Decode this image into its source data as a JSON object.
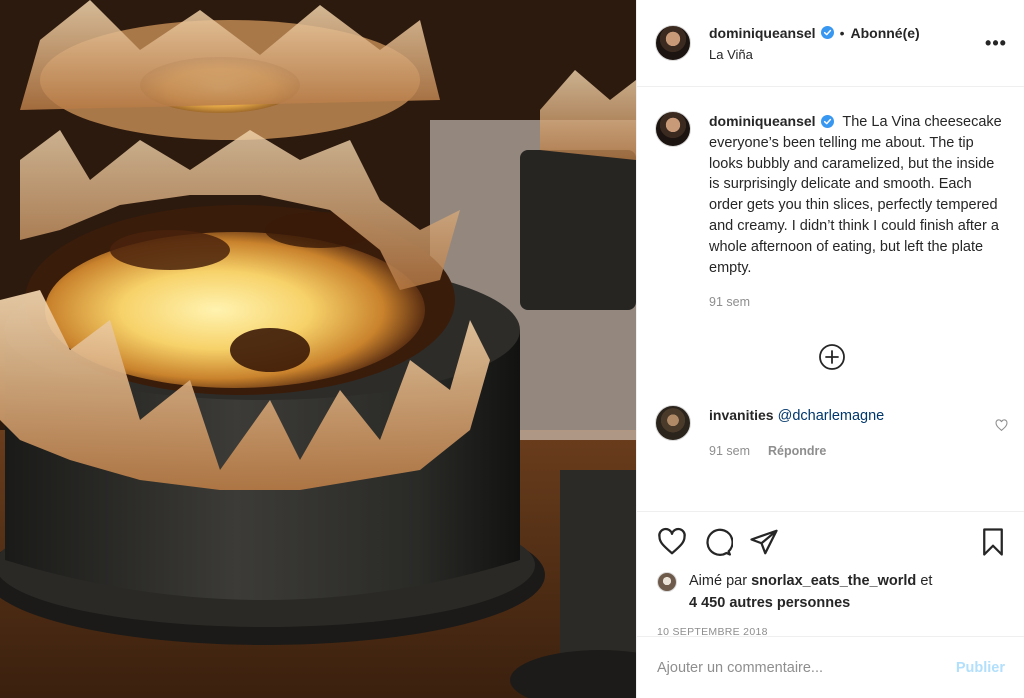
{
  "header": {
    "username": "dominiqueansel",
    "separator": "•",
    "follow_status": "Abonné(e)",
    "location": "La Viña",
    "more_label": "•••"
  },
  "caption": {
    "username": "dominiqueansel",
    "text": "The La Vina cheesecake everyone’s been telling me about. The tip looks bubbly and caramelized, but the inside is surprisingly delicate and smooth. Each order gets you thin slices, perfectly tempered and creamy. I didn’t think I could finish after a whole afternoon of eating, but left the plate empty.",
    "time": "91 sem"
  },
  "comments": [
    {
      "username": "invanities",
      "mention": "@dcharlemagne",
      "time": "91 sem",
      "reply_label": "Répondre"
    }
  ],
  "likes": {
    "prefix": "Aimé par",
    "liker": "snorlax_eats_the_world",
    "middle": "et",
    "others": "4 450 autres personnes"
  },
  "date": "10 SEPTEMBRE 2018",
  "add_comment": {
    "placeholder": "Ajouter un commentaire...",
    "publish_label": "Publier"
  },
  "colors": {
    "verified": "#3897f0",
    "mention": "#00376b",
    "publish_disabled": "#b2dffc",
    "meta_gray": "#8e8e8e"
  }
}
